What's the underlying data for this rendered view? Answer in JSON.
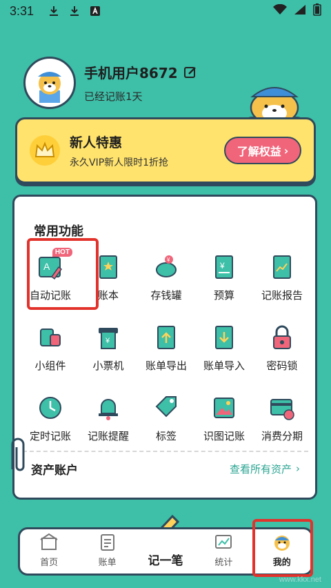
{
  "status_bar": {
    "time": "3:31"
  },
  "profile": {
    "username": "手机用户8672",
    "days": "已经记账1天"
  },
  "vip": {
    "title": "新人特惠",
    "subtitle": "永久VIP新人限时1折抢",
    "button": "了解权益"
  },
  "functions": {
    "title": "常用功能",
    "hot": "HOT",
    "items": [
      {
        "label": "自动记账",
        "icon": "auto-bookkeeping-icon"
      },
      {
        "label": "账本",
        "icon": "ledger-icon"
      },
      {
        "label": "存钱罐",
        "icon": "piggy-bank-icon"
      },
      {
        "label": "预算",
        "icon": "budget-icon"
      },
      {
        "label": "记账报告",
        "icon": "report-icon"
      },
      {
        "label": "小组件",
        "icon": "widget-icon"
      },
      {
        "label": "小票机",
        "icon": "receipt-printer-icon"
      },
      {
        "label": "账单导出",
        "icon": "export-bill-icon"
      },
      {
        "label": "账单导入",
        "icon": "import-bill-icon"
      },
      {
        "label": "密码锁",
        "icon": "lock-icon"
      },
      {
        "label": "定时记账",
        "icon": "clock-icon"
      },
      {
        "label": "记账提醒",
        "icon": "bell-icon"
      },
      {
        "label": "标签",
        "icon": "tag-icon"
      },
      {
        "label": "识图记账",
        "icon": "image-recognition-icon"
      },
      {
        "label": "消费分期",
        "icon": "installment-icon"
      }
    ]
  },
  "assets": {
    "title": "资产账户",
    "link": "查看所有资产"
  },
  "tabbar": {
    "home": "首页",
    "bill": "账单",
    "record": "记一笔",
    "stats": "统计",
    "mine": "我的"
  },
  "watermark": "www.kkx.net",
  "colors": {
    "background": "#3dbfa8",
    "vip": "#ffe36c",
    "accent": "#f0657a",
    "outline": "#2f4a5c",
    "highlight": "#e2322b"
  }
}
